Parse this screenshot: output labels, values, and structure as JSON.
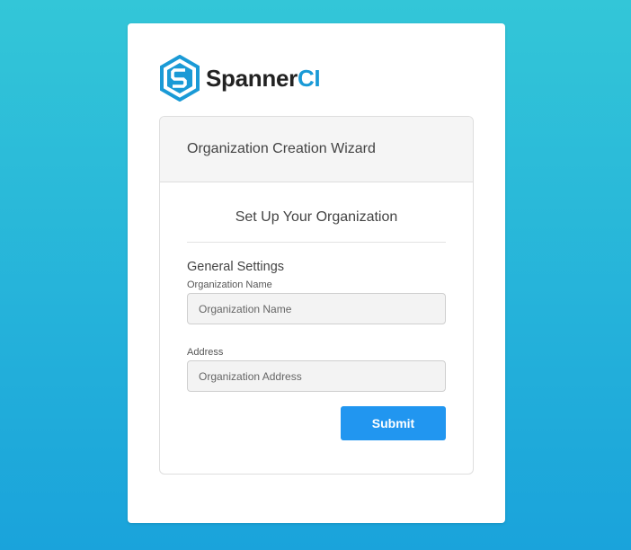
{
  "brand": {
    "name_main": "Spanner",
    "name_accent": "CI",
    "accent_color": "#1a9ad6",
    "icon": "spannerci-logo-icon"
  },
  "wizard": {
    "header_title": "Organization Creation Wizard",
    "section_title": "Set Up Your Organization",
    "group_title": "General Settings",
    "fields": [
      {
        "label": "Organization Name",
        "placeholder": "Organization Name",
        "value": ""
      },
      {
        "label": "Address",
        "placeholder": "Organization Address",
        "value": ""
      }
    ],
    "submit_label": "Submit",
    "submit_color": "#2196f0"
  },
  "theme": {
    "background_top": "#33c6d8",
    "background_bottom": "#1aa3db"
  }
}
